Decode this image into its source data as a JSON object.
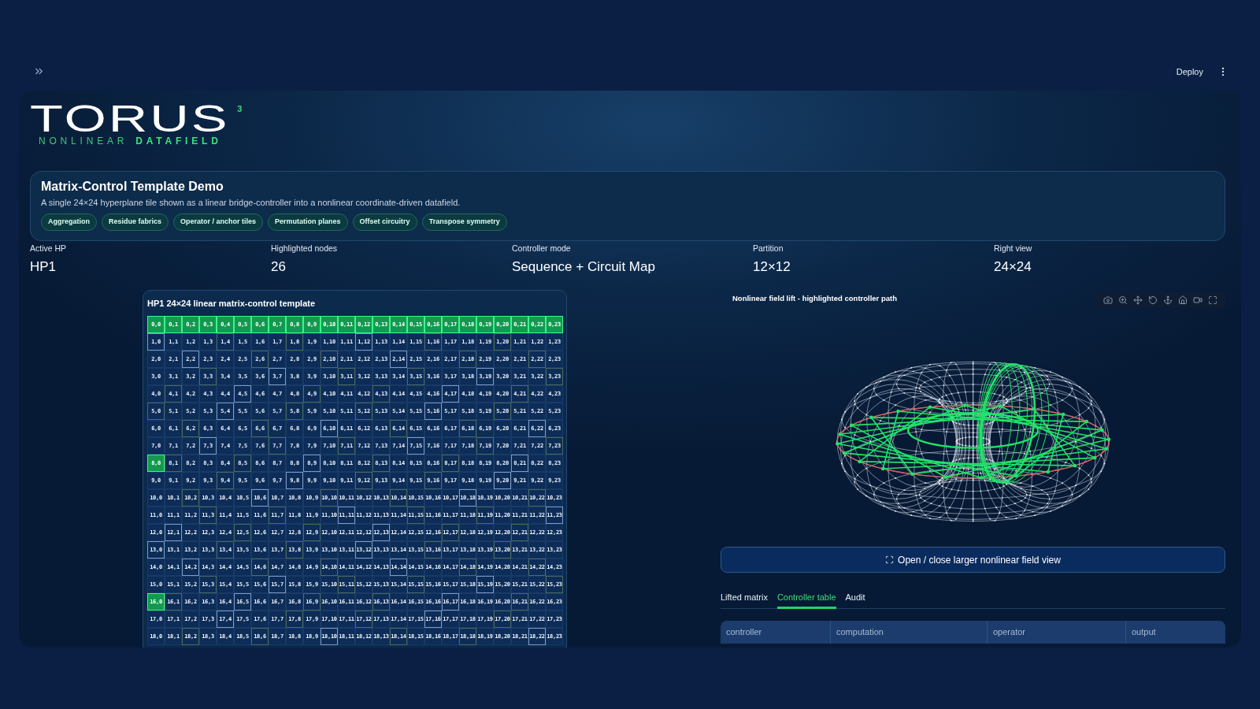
{
  "top_bar": {
    "deploy": "Deploy"
  },
  "logo": {
    "wordmark": "TORUS",
    "superscript": "3",
    "tagline": [
      {
        "text": "NONLINEAR",
        "bold": false
      },
      {
        "text": "DATAFIELD",
        "bold": true
      }
    ]
  },
  "intro": {
    "title": "Matrix-Control Template Demo",
    "description": "A single 24×24 hyperplane tile shown as a linear bridge-controller into a nonlinear coordinate-driven datafield.",
    "tags": [
      "Aggregation",
      "Residue fabrics",
      "Operator / anchor tiles",
      "Permutation planes",
      "Offset circuitry",
      "Transpose symmetry"
    ]
  },
  "stats": [
    {
      "label": "Active HP",
      "value": "HP1"
    },
    {
      "label": "Highlighted nodes",
      "value": "26"
    },
    {
      "label": "Controller mode",
      "value": "Sequence + Circuit Map"
    },
    {
      "label": "Partition",
      "value": "12×12"
    },
    {
      "label": "Right view",
      "value": "24×24"
    }
  ],
  "matrix": {
    "title": "HP1 24×24 linear matrix-control template",
    "rows": [
      [
        {
          "label": "0,0",
          "kind": "filled"
        },
        {
          "label": "0,1",
          "kind": "filled"
        },
        {
          "label": "0,2",
          "kind": "filled"
        },
        {
          "label": "0,3",
          "kind": "filled"
        },
        {
          "label": "0,4",
          "kind": "filled"
        },
        {
          "label": "0,5",
          "kind": "filled"
        },
        {
          "label": "0,6",
          "kind": "filled"
        },
        {
          "label": "0,7",
          "kind": "filled"
        },
        {
          "label": "0,8",
          "kind": "filled"
        },
        {
          "label": "0,9",
          "kind": "filled"
        },
        {
          "label": "0,10",
          "kind": "filled"
        },
        {
          "label": "0,11",
          "kind": "filled"
        },
        {
          "label": "0,12",
          "kind": "filled"
        },
        {
          "label": "0,13",
          "kind": "filled"
        },
        {
          "label": "0,14",
          "kind": "filled"
        },
        {
          "label": "0,15",
          "kind": "filled"
        },
        {
          "label": "0,16",
          "kind": "filled"
        },
        {
          "label": "0,17",
          "kind": "filled"
        },
        {
          "label": "0,18",
          "kind": "filled"
        },
        {
          "label": "0,19",
          "kind": "filled"
        },
        {
          "label": "0,20",
          "kind": "filled"
        },
        {
          "label": "0,21",
          "kind": "filled"
        },
        {
          "label": "0,22",
          "kind": "filled"
        },
        {
          "label": "0,23",
          "kind": "filled"
        }
      ],
      [
        {
          "label": "1,0",
          "kind": "outline"
        },
        {
          "label": "1,1",
          "kind": "plain"
        },
        {
          "label": "1,2",
          "kind": "plain"
        },
        {
          "label": "1,3",
          "kind": "plain"
        },
        {
          "label": "1,4",
          "kind": "faint_outline"
        },
        {
          "label": "1,5",
          "kind": "plain"
        },
        {
          "label": "1,6",
          "kind": "plain"
        },
        {
          "label": "1,7",
          "kind": "plain"
        },
        {
          "label": "1,8",
          "kind": "faint_outline"
        },
        {
          "label": "1,9",
          "kind": "plain"
        },
        {
          "label": "1,10",
          "kind": "plain"
        },
        {
          "label": "1,11",
          "kind": "plain"
        },
        {
          "label": "1,12",
          "kind": "outline"
        },
        {
          "label": "1,13",
          "kind": "plain"
        },
        {
          "label": "1,14",
          "kind": "plain"
        },
        {
          "label": "1,15",
          "kind": "plain"
        },
        {
          "label": "1,16",
          "kind": "faint_outline"
        },
        {
          "label": "1,17",
          "kind": "plain"
        },
        {
          "label": "1,18",
          "kind": "plain"
        },
        {
          "label": "1,19",
          "kind": "plain"
        },
        {
          "label": "1,20",
          "kind": "faint_outline"
        },
        {
          "label": "1,21",
          "kind": "plain"
        },
        {
          "label": "1,22",
          "kind": "plain"
        },
        {
          "label": "1,23",
          "kind": "plain"
        }
      ],
      [
        {
          "label": "2,0",
          "kind": "plain"
        },
        {
          "label": "2,1",
          "kind": "plain"
        },
        {
          "label": "2,2",
          "kind": "outline"
        },
        {
          "label": "2,3",
          "kind": "plain"
        },
        {
          "label": "2,4",
          "kind": "plain"
        },
        {
          "label": "2,5",
          "kind": "plain"
        },
        {
          "label": "2,6",
          "kind": "faint_outline"
        },
        {
          "label": "2,7",
          "kind": "plain"
        },
        {
          "label": "2,8",
          "kind": "plain"
        },
        {
          "label": "2,9",
          "kind": "plain"
        },
        {
          "label": "2,10",
          "kind": "faint_outline"
        },
        {
          "label": "2,11",
          "kind": "plain"
        },
        {
          "label": "2,12",
          "kind": "plain"
        },
        {
          "label": "2,13",
          "kind": "plain"
        },
        {
          "label": "2,14",
          "kind": "outline"
        },
        {
          "label": "2,15",
          "kind": "plain"
        },
        {
          "label": "2,16",
          "kind": "plain"
        },
        {
          "label": "2,17",
          "kind": "plain"
        },
        {
          "label": "2,18",
          "kind": "faint_outline"
        },
        {
          "label": "2,19",
          "kind": "plain"
        },
        {
          "label": "2,20",
          "kind": "plain"
        },
        {
          "label": "2,21",
          "kind": "plain"
        },
        {
          "label": "2,22",
          "kind": "faint_outline"
        },
        {
          "label": "2,23",
          "kind": "plain"
        }
      ],
      [
        {
          "label": "3,0",
          "kind": "plain"
        },
        {
          "label": "3,1",
          "kind": "plain"
        },
        {
          "label": "3,2",
          "kind": "plain"
        },
        {
          "label": "3,3",
          "kind": "faint_outline"
        },
        {
          "label": "3,4",
          "kind": "plain"
        },
        {
          "label": "3,5",
          "kind": "plain"
        },
        {
          "label": "3,6",
          "kind": "plain"
        },
        {
          "label": "3,7",
          "kind": "outline"
        },
        {
          "label": "3,8",
          "kind": "plain"
        },
        {
          "label": "3,9",
          "kind": "plain"
        },
        {
          "label": "3,10",
          "kind": "plain"
        },
        {
          "label": "3,11",
          "kind": "faint_outline"
        },
        {
          "label": "3,12",
          "kind": "plain"
        },
        {
          "label": "3,13",
          "kind": "plain"
        },
        {
          "label": "3,14",
          "kind": "plain"
        },
        {
          "label": "3,15",
          "kind": "faint_outline"
        },
        {
          "label": "3,16",
          "kind": "plain"
        },
        {
          "label": "3,17",
          "kind": "plain"
        },
        {
          "label": "3,18",
          "kind": "plain"
        },
        {
          "label": "3,19",
          "kind": "outline"
        },
        {
          "label": "3,20",
          "kind": "plain"
        },
        {
          "label": "3,21",
          "kind": "plain"
        },
        {
          "label": "3,22",
          "kind": "plain"
        },
        {
          "label": "3,23",
          "kind": "faint_outline"
        }
      ],
      [
        {
          "label": "4,0",
          "kind": "plain"
        },
        {
          "label": "4,1",
          "kind": "faint_outline"
        },
        {
          "label": "4,2",
          "kind": "plain"
        },
        {
          "label": "4,3",
          "kind": "plain"
        },
        {
          "label": "4,4",
          "kind": "plain"
        },
        {
          "label": "4,5",
          "kind": "outline"
        },
        {
          "label": "4,6",
          "kind": "plain"
        },
        {
          "label": "4,7",
          "kind": "plain"
        },
        {
          "label": "4,8",
          "kind": "plain"
        },
        {
          "label": "4,9",
          "kind": "faint_outline"
        },
        {
          "label": "4,10",
          "kind": "plain"
        },
        {
          "label": "4,11",
          "kind": "plain"
        },
        {
          "label": "4,12",
          "kind": "plain"
        },
        {
          "label": "4,13",
          "kind": "faint_outline"
        },
        {
          "label": "4,14",
          "kind": "plain"
        },
        {
          "label": "4,15",
          "kind": "plain"
        },
        {
          "label": "4,16",
          "kind": "plain"
        },
        {
          "label": "4,17",
          "kind": "outline"
        },
        {
          "label": "4,18",
          "kind": "plain"
        },
        {
          "label": "4,19",
          "kind": "plain"
        },
        {
          "label": "4,20",
          "kind": "plain"
        },
        {
          "label": "4,21",
          "kind": "faint_outline"
        },
        {
          "label": "4,22",
          "kind": "plain"
        },
        {
          "label": "4,23",
          "kind": "plain"
        }
      ],
      [
        {
          "label": "5,0",
          "kind": "faint_outline"
        },
        {
          "label": "5,1",
          "kind": "plain"
        },
        {
          "label": "5,2",
          "kind": "plain"
        },
        {
          "label": "5,3",
          "kind": "plain"
        },
        {
          "label": "5,4",
          "kind": "outline"
        },
        {
          "label": "5,5",
          "kind": "plain"
        },
        {
          "label": "5,6",
          "kind": "plain"
        },
        {
          "label": "5,7",
          "kind": "plain"
        },
        {
          "label": "5,8",
          "kind": "faint_outline"
        },
        {
          "label": "5,9",
          "kind": "plain"
        },
        {
          "label": "5,10",
          "kind": "plain"
        },
        {
          "label": "5,11",
          "kind": "plain"
        },
        {
          "label": "5,12",
          "kind": "faint_outline"
        },
        {
          "label": "5,13",
          "kind": "plain"
        },
        {
          "label": "5,14",
          "kind": "plain"
        },
        {
          "label": "5,15",
          "kind": "plain"
        },
        {
          "label": "5,16",
          "kind": "outline"
        },
        {
          "label": "5,17",
          "kind": "plain"
        },
        {
          "label": "5,18",
          "kind": "plain"
        },
        {
          "label": "5,19",
          "kind": "plain"
        },
        {
          "label": "5,20",
          "kind": "faint_outline"
        },
        {
          "label": "5,21",
          "kind": "plain"
        },
        {
          "label": "5,22",
          "kind": "plain"
        },
        {
          "label": "5,23",
          "kind": "plain"
        }
      ],
      [
        {
          "label": "6,0",
          "kind": "plain"
        },
        {
          "label": "6,1",
          "kind": "plain"
        },
        {
          "label": "6,2",
          "kind": "faint_outline"
        },
        {
          "label": "6,3",
          "kind": "plain"
        },
        {
          "label": "6,4",
          "kind": "plain"
        },
        {
          "label": "6,5",
          "kind": "plain"
        },
        {
          "label": "6,6",
          "kind": "faint_outline"
        },
        {
          "label": "6,7",
          "kind": "plain"
        },
        {
          "label": "6,8",
          "kind": "plain"
        },
        {
          "label": "6,9",
          "kind": "plain"
        },
        {
          "label": "6,10",
          "kind": "outline"
        },
        {
          "label": "6,11",
          "kind": "plain"
        },
        {
          "label": "6,12",
          "kind": "plain"
        },
        {
          "label": "6,13",
          "kind": "plain"
        },
        {
          "label": "6,14",
          "kind": "faint_outline"
        },
        {
          "label": "6,15",
          "kind": "plain"
        },
        {
          "label": "6,16",
          "kind": "plain"
        },
        {
          "label": "6,17",
          "kind": "plain"
        },
        {
          "label": "6,18",
          "kind": "faint_outline"
        },
        {
          "label": "6,19",
          "kind": "plain"
        },
        {
          "label": "6,20",
          "kind": "plain"
        },
        {
          "label": "6,21",
          "kind": "plain"
        },
        {
          "label": "6,22",
          "kind": "outline"
        },
        {
          "label": "6,23",
          "kind": "plain"
        }
      ],
      [
        {
          "label": "7,0",
          "kind": "plain"
        },
        {
          "label": "7,1",
          "kind": "plain"
        },
        {
          "label": "7,2",
          "kind": "plain"
        },
        {
          "label": "7,3",
          "kind": "outline"
        },
        {
          "label": "7,4",
          "kind": "plain"
        },
        {
          "label": "7,5",
          "kind": "plain"
        },
        {
          "label": "7,6",
          "kind": "plain"
        },
        {
          "label": "7,7",
          "kind": "faint_outline"
        },
        {
          "label": "7,8",
          "kind": "plain"
        },
        {
          "label": "7,9",
          "kind": "plain"
        },
        {
          "label": "7,10",
          "kind": "plain"
        },
        {
          "label": "7,11",
          "kind": "faint_outline"
        },
        {
          "label": "7,12",
          "kind": "plain"
        },
        {
          "label": "7,13",
          "kind": "plain"
        },
        {
          "label": "7,14",
          "kind": "plain"
        },
        {
          "label": "7,15",
          "kind": "outline"
        },
        {
          "label": "7,16",
          "kind": "plain"
        },
        {
          "label": "7,17",
          "kind": "plain"
        },
        {
          "label": "7,18",
          "kind": "plain"
        },
        {
          "label": "7,19",
          "kind": "faint_outline"
        },
        {
          "label": "7,20",
          "kind": "plain"
        },
        {
          "label": "7,21",
          "kind": "plain"
        },
        {
          "label": "7,22",
          "kind": "plain"
        },
        {
          "label": "7,23",
          "kind": "faint_outline"
        }
      ],
      [
        {
          "label": "8,0",
          "kind": "filled"
        },
        {
          "label": "8,1",
          "kind": "faint_outline"
        },
        {
          "label": "8,2",
          "kind": "plain"
        },
        {
          "label": "8,3",
          "kind": "plain"
        },
        {
          "label": "8,4",
          "kind": "plain"
        },
        {
          "label": "8,5",
          "kind": "faint_outline"
        },
        {
          "label": "8,6",
          "kind": "plain"
        },
        {
          "label": "8,7",
          "kind": "plain"
        },
        {
          "label": "8,8",
          "kind": "plain"
        },
        {
          "label": "8,9",
          "kind": "outline"
        },
        {
          "label": "8,10",
          "kind": "plain"
        },
        {
          "label": "8,11",
          "kind": "plain"
        },
        {
          "label": "8,12",
          "kind": "plain"
        },
        {
          "label": "8,13",
          "kind": "faint_outline"
        },
        {
          "label": "8,14",
          "kind": "plain"
        },
        {
          "label": "8,15",
          "kind": "plain"
        },
        {
          "label": "8,16",
          "kind": "plain"
        },
        {
          "label": "8,17",
          "kind": "faint_outline"
        },
        {
          "label": "8,18",
          "kind": "plain"
        },
        {
          "label": "8,19",
          "kind": "plain"
        },
        {
          "label": "8,20",
          "kind": "plain"
        },
        {
          "label": "8,21",
          "kind": "outline"
        },
        {
          "label": "8,22",
          "kind": "plain"
        },
        {
          "label": "8,23",
          "kind": "plain"
        }
      ],
      [
        {
          "label": "9,0",
          "kind": "plain"
        },
        {
          "label": "9,1",
          "kind": "plain"
        },
        {
          "label": "9,2",
          "kind": "plain"
        },
        {
          "label": "9,3",
          "kind": "plain"
        },
        {
          "label": "9,4",
          "kind": "faint_outline"
        },
        {
          "label": "9,5",
          "kind": "plain"
        },
        {
          "label": "9,6",
          "kind": "plain"
        },
        {
          "label": "9,7",
          "kind": "plain"
        },
        {
          "label": "9,8",
          "kind": "outline"
        },
        {
          "label": "9,9",
          "kind": "plain"
        },
        {
          "label": "9,10",
          "kind": "plain"
        },
        {
          "label": "9,11",
          "kind": "plain"
        },
        {
          "label": "9,12",
          "kind": "faint_outline"
        },
        {
          "label": "9,13",
          "kind": "plain"
        },
        {
          "label": "9,14",
          "kind": "plain"
        },
        {
          "label": "9,15",
          "kind": "plain"
        },
        {
          "label": "9,16",
          "kind": "faint_outline"
        },
        {
          "label": "9,17",
          "kind": "plain"
        },
        {
          "label": "9,18",
          "kind": "plain"
        },
        {
          "label": "9,19",
          "kind": "plain"
        },
        {
          "label": "9,20",
          "kind": "outline"
        },
        {
          "label": "9,21",
          "kind": "plain"
        },
        {
          "label": "9,22",
          "kind": "plain"
        },
        {
          "label": "9,23",
          "kind": "plain"
        }
      ],
      [
        {
          "label": "10,0",
          "kind": "plain"
        },
        {
          "label": "10,1",
          "kind": "plain"
        },
        {
          "label": "10,2",
          "kind": "faint_outline"
        },
        {
          "label": "10,3",
          "kind": "plain"
        },
        {
          "label": "10,4",
          "kind": "plain"
        },
        {
          "label": "10,5",
          "kind": "plain"
        },
        {
          "label": "10,6",
          "kind": "outline"
        },
        {
          "label": "10,7",
          "kind": "plain"
        },
        {
          "label": "10,8",
          "kind": "plain"
        },
        {
          "label": "10,9",
          "kind": "plain"
        },
        {
          "label": "10,10",
          "kind": "faint_outline"
        },
        {
          "label": "10,11",
          "kind": "plain"
        },
        {
          "label": "10,12",
          "kind": "plain"
        },
        {
          "label": "10,13",
          "kind": "plain"
        },
        {
          "label": "10,14",
          "kind": "faint_outline"
        },
        {
          "label": "10,15",
          "kind": "plain"
        },
        {
          "label": "10,16",
          "kind": "plain"
        },
        {
          "label": "10,17",
          "kind": "plain"
        },
        {
          "label": "10,18",
          "kind": "outline"
        },
        {
          "label": "10,19",
          "kind": "plain"
        },
        {
          "label": "10,20",
          "kind": "plain"
        },
        {
          "label": "10,21",
          "kind": "plain"
        },
        {
          "label": "10,22",
          "kind": "faint_outline"
        },
        {
          "label": "10,23",
          "kind": "plain"
        }
      ],
      [
        {
          "label": "11,0",
          "kind": "plain"
        },
        {
          "label": "11,1",
          "kind": "plain"
        },
        {
          "label": "11,2",
          "kind": "plain"
        },
        {
          "label": "11,3",
          "kind": "faint_outline"
        },
        {
          "label": "11,4",
          "kind": "plain"
        },
        {
          "label": "11,5",
          "kind": "plain"
        },
        {
          "label": "11,6",
          "kind": "plain"
        },
        {
          "label": "11,7",
          "kind": "faint_outline"
        },
        {
          "label": "11,8",
          "kind": "plain"
        },
        {
          "label": "11,9",
          "kind": "plain"
        },
        {
          "label": "11,10",
          "kind": "plain"
        },
        {
          "label": "11,11",
          "kind": "outline"
        },
        {
          "label": "11,12",
          "kind": "plain"
        },
        {
          "label": "11,13",
          "kind": "plain"
        },
        {
          "label": "11,14",
          "kind": "plain"
        },
        {
          "label": "11,15",
          "kind": "faint_outline"
        },
        {
          "label": "11,16",
          "kind": "plain"
        },
        {
          "label": "11,17",
          "kind": "plain"
        },
        {
          "label": "11,18",
          "kind": "plain"
        },
        {
          "label": "11,19",
          "kind": "faint_outline"
        },
        {
          "label": "11,20",
          "kind": "plain"
        },
        {
          "label": "11,21",
          "kind": "plain"
        },
        {
          "label": "11,22",
          "kind": "plain"
        },
        {
          "label": "11,23",
          "kind": "outline"
        }
      ],
      [
        {
          "label": "12,0",
          "kind": "plain"
        },
        {
          "label": "12,1",
          "kind": "outline"
        },
        {
          "label": "12,2",
          "kind": "plain"
        },
        {
          "label": "12,3",
          "kind": "plain"
        },
        {
          "label": "12,4",
          "kind": "plain"
        },
        {
          "label": "12,5",
          "kind": "faint_outline"
        },
        {
          "label": "12,6",
          "kind": "plain"
        },
        {
          "label": "12,7",
          "kind": "plain"
        },
        {
          "label": "12,8",
          "kind": "plain"
        },
        {
          "label": "12,9",
          "kind": "faint_outline"
        },
        {
          "label": "12,10",
          "kind": "plain"
        },
        {
          "label": "12,11",
          "kind": "plain"
        },
        {
          "label": "12,12",
          "kind": "plain"
        },
        {
          "label": "12,13",
          "kind": "outline"
        },
        {
          "label": "12,14",
          "kind": "plain"
        },
        {
          "label": "12,15",
          "kind": "plain"
        },
        {
          "label": "12,16",
          "kind": "plain"
        },
        {
          "label": "12,17",
          "kind": "faint_outline"
        },
        {
          "label": "12,18",
          "kind": "plain"
        },
        {
          "label": "12,19",
          "kind": "plain"
        },
        {
          "label": "12,20",
          "kind": "plain"
        },
        {
          "label": "12,21",
          "kind": "faint_outline"
        },
        {
          "label": "12,22",
          "kind": "plain"
        },
        {
          "label": "12,23",
          "kind": "plain"
        }
      ],
      [
        {
          "label": "13,0",
          "kind": "outline"
        },
        {
          "label": "13,1",
          "kind": "plain"
        },
        {
          "label": "13,2",
          "kind": "plain"
        },
        {
          "label": "13,3",
          "kind": "plain"
        },
        {
          "label": "13,4",
          "kind": "faint_outline"
        },
        {
          "label": "13,5",
          "kind": "plain"
        },
        {
          "label": "13,6",
          "kind": "plain"
        },
        {
          "label": "13,7",
          "kind": "plain"
        },
        {
          "label": "13,8",
          "kind": "faint_outline"
        },
        {
          "label": "13,9",
          "kind": "plain"
        },
        {
          "label": "13,10",
          "kind": "plain"
        },
        {
          "label": "13,11",
          "kind": "plain"
        },
        {
          "label": "13,12",
          "kind": "outline"
        },
        {
          "label": "13,13",
          "kind": "plain"
        },
        {
          "label": "13,14",
          "kind": "plain"
        },
        {
          "label": "13,15",
          "kind": "plain"
        },
        {
          "label": "13,16",
          "kind": "faint_outline"
        },
        {
          "label": "13,17",
          "kind": "plain"
        },
        {
          "label": "13,18",
          "kind": "plain"
        },
        {
          "label": "13,19",
          "kind": "plain"
        },
        {
          "label": "13,20",
          "kind": "faint_outline"
        },
        {
          "label": "13,21",
          "kind": "plain"
        },
        {
          "label": "13,22",
          "kind": "plain"
        },
        {
          "label": "13,23",
          "kind": "plain"
        }
      ],
      [
        {
          "label": "14,0",
          "kind": "plain"
        },
        {
          "label": "14,1",
          "kind": "plain"
        },
        {
          "label": "14,2",
          "kind": "outline"
        },
        {
          "label": "14,3",
          "kind": "plain"
        },
        {
          "label": "14,4",
          "kind": "plain"
        },
        {
          "label": "14,5",
          "kind": "plain"
        },
        {
          "label": "14,6",
          "kind": "faint_outline"
        },
        {
          "label": "14,7",
          "kind": "plain"
        },
        {
          "label": "14,8",
          "kind": "plain"
        },
        {
          "label": "14,9",
          "kind": "plain"
        },
        {
          "label": "14,10",
          "kind": "faint_outline"
        },
        {
          "label": "14,11",
          "kind": "plain"
        },
        {
          "label": "14,12",
          "kind": "plain"
        },
        {
          "label": "14,13",
          "kind": "plain"
        },
        {
          "label": "14,14",
          "kind": "outline"
        },
        {
          "label": "14,15",
          "kind": "plain"
        },
        {
          "label": "14,16",
          "kind": "plain"
        },
        {
          "label": "14,17",
          "kind": "plain"
        },
        {
          "label": "14,18",
          "kind": "faint_outline"
        },
        {
          "label": "14,19",
          "kind": "plain"
        },
        {
          "label": "14,20",
          "kind": "plain"
        },
        {
          "label": "14,21",
          "kind": "plain"
        },
        {
          "label": "14,22",
          "kind": "faint_outline"
        },
        {
          "label": "14,23",
          "kind": "plain"
        }
      ],
      [
        {
          "label": "15,0",
          "kind": "plain"
        },
        {
          "label": "15,1",
          "kind": "plain"
        },
        {
          "label": "15,2",
          "kind": "plain"
        },
        {
          "label": "15,3",
          "kind": "faint_outline"
        },
        {
          "label": "15,4",
          "kind": "plain"
        },
        {
          "label": "15,5",
          "kind": "plain"
        },
        {
          "label": "15,6",
          "kind": "plain"
        },
        {
          "label": "15,7",
          "kind": "outline"
        },
        {
          "label": "15,8",
          "kind": "plain"
        },
        {
          "label": "15,9",
          "kind": "plain"
        },
        {
          "label": "15,10",
          "kind": "plain"
        },
        {
          "label": "15,11",
          "kind": "faint_outline"
        },
        {
          "label": "15,12",
          "kind": "plain"
        },
        {
          "label": "15,13",
          "kind": "plain"
        },
        {
          "label": "15,14",
          "kind": "plain"
        },
        {
          "label": "15,15",
          "kind": "faint_outline"
        },
        {
          "label": "15,16",
          "kind": "plain"
        },
        {
          "label": "15,17",
          "kind": "plain"
        },
        {
          "label": "15,18",
          "kind": "plain"
        },
        {
          "label": "15,19",
          "kind": "outline"
        },
        {
          "label": "15,20",
          "kind": "plain"
        },
        {
          "label": "15,21",
          "kind": "plain"
        },
        {
          "label": "15,22",
          "kind": "plain"
        },
        {
          "label": "15,23",
          "kind": "faint_outline"
        }
      ],
      [
        {
          "label": "16,0",
          "kind": "filled"
        },
        {
          "label": "16,1",
          "kind": "faint_outline"
        },
        {
          "label": "16,2",
          "kind": "plain"
        },
        {
          "label": "16,3",
          "kind": "plain"
        },
        {
          "label": "16,4",
          "kind": "plain"
        },
        {
          "label": "16,5",
          "kind": "outline"
        },
        {
          "label": "16,6",
          "kind": "plain"
        },
        {
          "label": "16,7",
          "kind": "plain"
        },
        {
          "label": "16,8",
          "kind": "plain"
        },
        {
          "label": "16,9",
          "kind": "faint_outline"
        },
        {
          "label": "16,10",
          "kind": "plain"
        },
        {
          "label": "16,11",
          "kind": "plain"
        },
        {
          "label": "16,12",
          "kind": "plain"
        },
        {
          "label": "16,13",
          "kind": "faint_outline"
        },
        {
          "label": "16,14",
          "kind": "plain"
        },
        {
          "label": "16,15",
          "kind": "plain"
        },
        {
          "label": "16,16",
          "kind": "plain"
        },
        {
          "label": "16,17",
          "kind": "outline"
        },
        {
          "label": "16,18",
          "kind": "plain"
        },
        {
          "label": "16,19",
          "kind": "plain"
        },
        {
          "label": "16,20",
          "kind": "plain"
        },
        {
          "label": "16,21",
          "kind": "faint_outline"
        },
        {
          "label": "16,22",
          "kind": "plain"
        },
        {
          "label": "16,23",
          "kind": "plain"
        }
      ],
      [
        {
          "label": "17,0",
          "kind": "plain"
        },
        {
          "label": "17,1",
          "kind": "plain"
        },
        {
          "label": "17,2",
          "kind": "plain"
        },
        {
          "label": "17,3",
          "kind": "plain"
        },
        {
          "label": "17,4",
          "kind": "outline"
        },
        {
          "label": "17,5",
          "kind": "plain"
        },
        {
          "label": "17,6",
          "kind": "plain"
        },
        {
          "label": "17,7",
          "kind": "plain"
        },
        {
          "label": "17,8",
          "kind": "faint_outline"
        },
        {
          "label": "17,9",
          "kind": "plain"
        },
        {
          "label": "17,10",
          "kind": "plain"
        },
        {
          "label": "17,11",
          "kind": "plain"
        },
        {
          "label": "17,12",
          "kind": "faint_outline"
        },
        {
          "label": "17,13",
          "kind": "plain"
        },
        {
          "label": "17,14",
          "kind": "plain"
        },
        {
          "label": "17,15",
          "kind": "plain"
        },
        {
          "label": "17,16",
          "kind": "outline"
        },
        {
          "label": "17,17",
          "kind": "plain"
        },
        {
          "label": "17,18",
          "kind": "plain"
        },
        {
          "label": "17,19",
          "kind": "plain"
        },
        {
          "label": "17,20",
          "kind": "faint_outline"
        },
        {
          "label": "17,21",
          "kind": "plain"
        },
        {
          "label": "17,22",
          "kind": "plain"
        },
        {
          "label": "17,23",
          "kind": "plain"
        }
      ],
      [
        {
          "label": "18,0",
          "kind": "plain"
        },
        {
          "label": "18,1",
          "kind": "plain"
        },
        {
          "label": "18,2",
          "kind": "faint_outline"
        },
        {
          "label": "18,3",
          "kind": "plain"
        },
        {
          "label": "18,4",
          "kind": "plain"
        },
        {
          "label": "18,5",
          "kind": "plain"
        },
        {
          "label": "18,6",
          "kind": "faint_outline"
        },
        {
          "label": "18,7",
          "kind": "plain"
        },
        {
          "label": "18,8",
          "kind": "plain"
        },
        {
          "label": "18,9",
          "kind": "plain"
        },
        {
          "label": "18,10",
          "kind": "outline"
        },
        {
          "label": "18,11",
          "kind": "plain"
        },
        {
          "label": "18,12",
          "kind": "plain"
        },
        {
          "label": "18,13",
          "kind": "plain"
        },
        {
          "label": "18,14",
          "kind": "faint_outline"
        },
        {
          "label": "18,15",
          "kind": "plain"
        },
        {
          "label": "18,16",
          "kind": "plain"
        },
        {
          "label": "18,17",
          "kind": "plain"
        },
        {
          "label": "18,18",
          "kind": "faint_outline"
        },
        {
          "label": "18,19",
          "kind": "plain"
        },
        {
          "label": "18,20",
          "kind": "plain"
        },
        {
          "label": "18,21",
          "kind": "plain"
        },
        {
          "label": "18,22",
          "kind": "outline"
        },
        {
          "label": "18,23",
          "kind": "plain"
        }
      ]
    ]
  },
  "field_view": {
    "title": "Nonlinear field lift - highlighted controller path",
    "toggle_button": "Open / close larger nonlinear field view"
  },
  "tabs": [
    {
      "label": "Lifted matrix",
      "selected": false
    },
    {
      "label": "Controller table",
      "selected": true
    },
    {
      "label": "Audit",
      "selected": false
    }
  ],
  "table": {
    "columns": [
      "controller",
      "computation",
      "operator",
      "output"
    ]
  }
}
